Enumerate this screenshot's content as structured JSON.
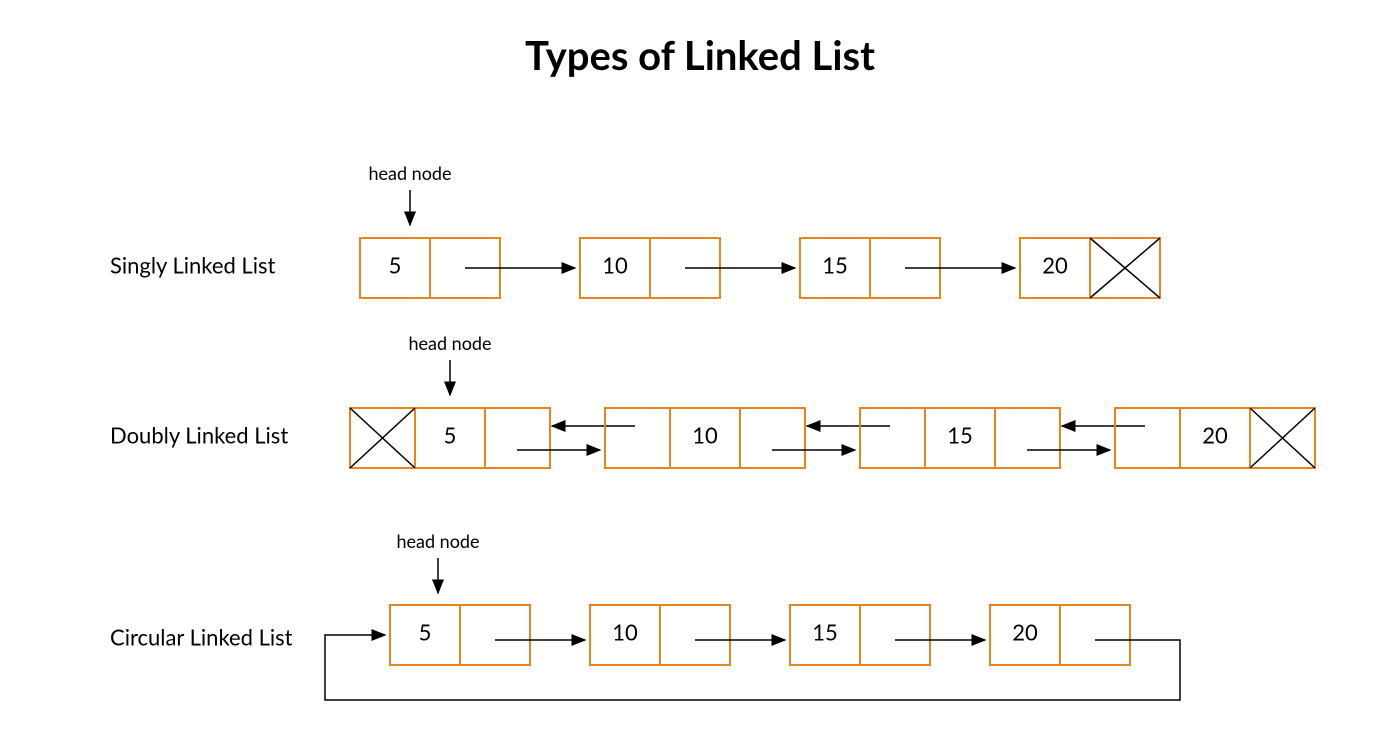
{
  "title": "Types of Linked List",
  "headLabel": "head node",
  "rows": {
    "singly": {
      "label": "Singly Linked List",
      "values": [
        "5",
        "10",
        "15",
        "20"
      ]
    },
    "doubly": {
      "label": "Doubly Linked List",
      "values": [
        "5",
        "10",
        "15",
        "20"
      ]
    },
    "circular": {
      "label": "Circular Linked List",
      "values": [
        "5",
        "10",
        "15",
        "20"
      ]
    }
  }
}
